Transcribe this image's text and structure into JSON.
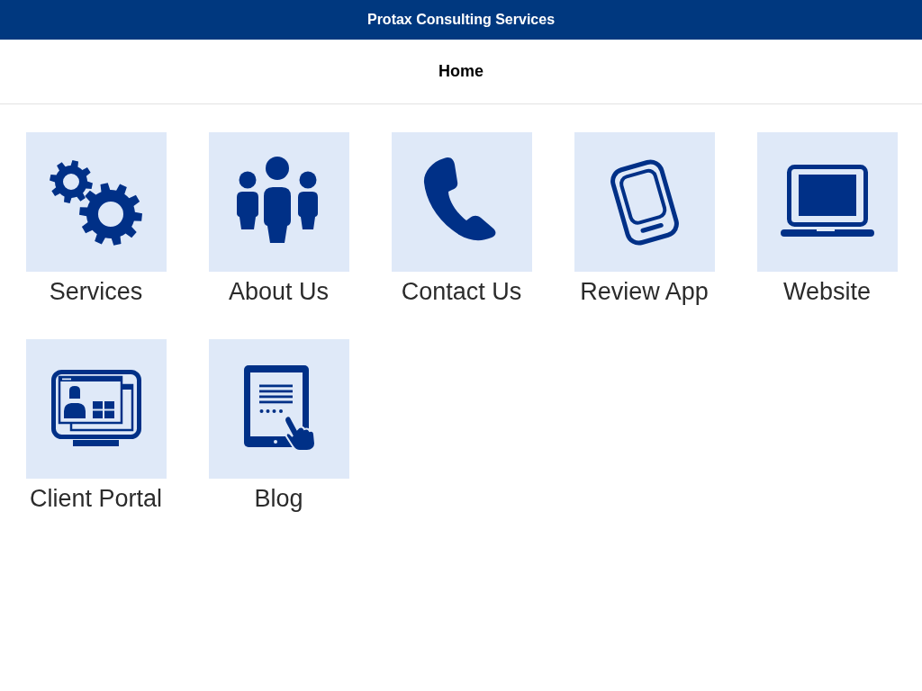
{
  "header": {
    "title": "Protax Consulting Services"
  },
  "nav_bar": {
    "title": "Home"
  },
  "tiles": [
    {
      "label": "Services",
      "kind": "gears"
    },
    {
      "label": "About Us",
      "kind": "people"
    },
    {
      "label": "Contact Us",
      "kind": "phone"
    },
    {
      "label": "Review App",
      "kind": "mobile"
    },
    {
      "label": "Website",
      "kind": "laptop"
    },
    {
      "label": "Client Portal",
      "kind": "monitor"
    },
    {
      "label": "Blog",
      "kind": "tablet"
    }
  ]
}
